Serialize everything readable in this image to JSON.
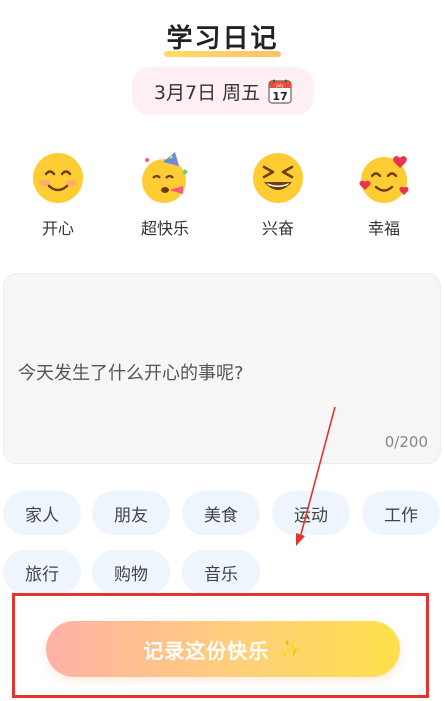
{
  "header": {
    "title": "学习日记"
  },
  "date": {
    "text": "3月7日 周五",
    "calendar_month": "July",
    "calendar_day": "17"
  },
  "moods": [
    {
      "label": "开心",
      "icon": "smiling-face-icon"
    },
    {
      "label": "超快乐",
      "icon": "party-face-icon"
    },
    {
      "label": "兴奋",
      "icon": "grinning-squint-face-icon"
    },
    {
      "label": "幸福",
      "icon": "face-with-hearts-icon"
    }
  ],
  "entry": {
    "placeholder": "今天发生了什么开心的事呢?",
    "counter": "0/200"
  },
  "tags": [
    "家人",
    "朋友",
    "美食",
    "运动",
    "工作",
    "旅行",
    "购物",
    "音乐"
  ],
  "submit": {
    "label": "记录这份快乐",
    "sparkle": "✨"
  },
  "colors": {
    "highlight_frame": "#e3342f",
    "tag_bg": "#eef5fc",
    "date_bg": "#fdeff2",
    "cta_start": "#ffb1a6",
    "cta_end": "#ffe04a"
  }
}
